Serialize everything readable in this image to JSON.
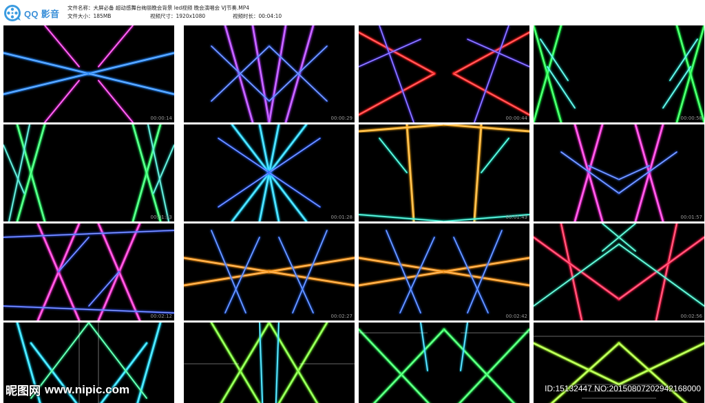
{
  "app": {
    "name_latin": "QQ",
    "name_cn": "影音"
  },
  "file_info": {
    "name_label": "文件名称：",
    "name_value": "大屏必备 超动感舞台绚丽晚会背景 led视频 晚会演唱会 VJ节奏.MP4",
    "size_label": "文件大小：",
    "size_value": "185MB",
    "dims_label": "视频尺寸：",
    "dims_value": "1920x1080",
    "duration_label": "视频时长：",
    "duration_value": "00:04:10"
  },
  "thumbnails": [
    {
      "time": "00:00:14",
      "colors": [
        "#2a8cff",
        "#ff2df0"
      ]
    },
    {
      "time": "00:00:29",
      "colors": [
        "#b43cff",
        "#3c6cff"
      ]
    },
    {
      "time": "00:00:44",
      "colors": [
        "#ff2020",
        "#5a3cff"
      ]
    },
    {
      "time": "00:00:58",
      "colors": [
        "#1eff4a",
        "#2ef0e0"
      ]
    },
    {
      "time": "00:01:13",
      "colors": [
        "#2cff6a",
        "#36e6d0"
      ]
    },
    {
      "time": "00:01:28",
      "colors": [
        "#20d8ff",
        "#2a5cff"
      ]
    },
    {
      "time": "00:01:43",
      "colors": [
        "#ffb020",
        "#20f0d0"
      ]
    },
    {
      "time": "00:01:57",
      "colors": [
        "#ff30e0",
        "#3a6cff"
      ]
    },
    {
      "time": "00:02:12",
      "colors": [
        "#ff30d8",
        "#3a5cff"
      ]
    },
    {
      "time": "00:02:27",
      "colors": [
        "#ff9a1e",
        "#2f6cff"
      ]
    },
    {
      "time": "00:02:42",
      "colors": [
        "#ff9a1e",
        "#2f6cff"
      ]
    },
    {
      "time": "00:02:56",
      "colors": [
        "#ff2050",
        "#30f0c8"
      ]
    },
    {
      "time": "",
      "colors": [
        "#20e0ff",
        "#30ff9a"
      ]
    },
    {
      "time": "",
      "colors": [
        "#7aff30",
        "#20e0ff"
      ]
    },
    {
      "time": "",
      "colors": [
        "#30ff60",
        "#20d8ff"
      ]
    },
    {
      "time": "",
      "colors": [
        "#aaff30",
        "#30ff60"
      ]
    }
  ],
  "watermark": {
    "site_cn": "昵图网",
    "site_url": "www.nipic.com",
    "id_text": "ID:15132447 NO:20150807202942168000"
  }
}
